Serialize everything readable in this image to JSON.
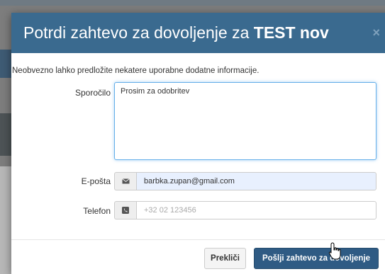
{
  "modal": {
    "title_prefix": "Potrdi zahtevo za dovoljenje za ",
    "title_bold": "TEST nov",
    "close_label": "×",
    "intro": "Neobvezno lahko predložite nekatere uporabne dodatne informacije."
  },
  "form": {
    "message_label": "Sporočilo",
    "message_value": "Prosim za odobritev",
    "email_label": "E-pošta",
    "email_value": "barbka.zupan@gmail.com",
    "email_icon": "envelope-icon",
    "phone_label": "Telefon",
    "phone_placeholder": "+32 02 123456",
    "phone_icon": "phone-icon"
  },
  "footer": {
    "cancel_label": "Prekliči",
    "submit_label": "Pošlji zahtevo za dovoljenje"
  },
  "colors": {
    "header_bg": "#3a6a8f",
    "submit_bg": "#2f5b84",
    "focus_border": "#66afe9"
  }
}
